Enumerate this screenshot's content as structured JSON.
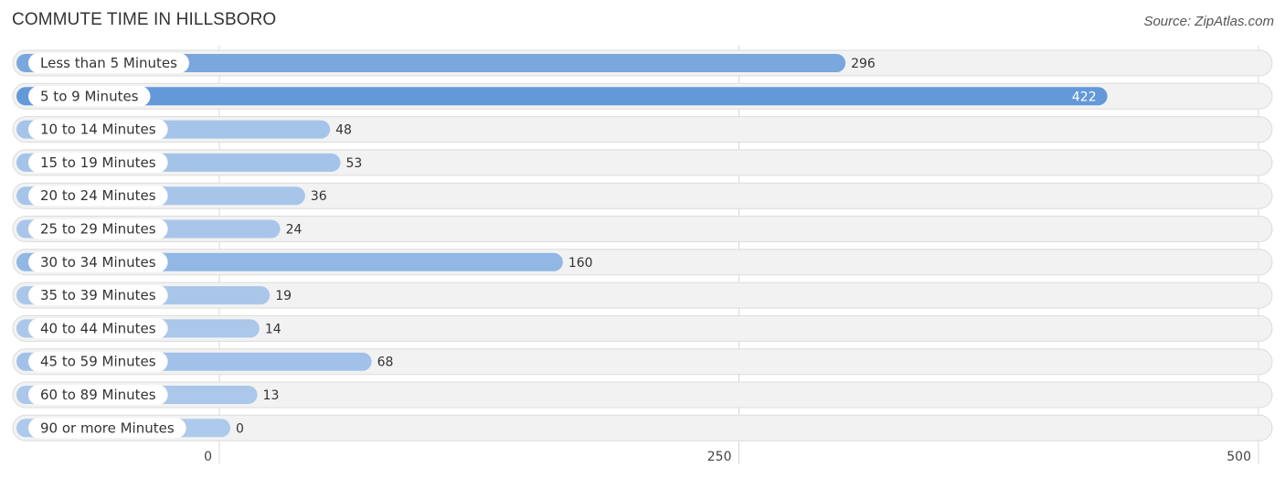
{
  "chart_data": {
    "type": "bar",
    "orientation": "horizontal",
    "title": "COMMUTE TIME IN HILLSBORO",
    "source": "Source: ZipAtlas.com",
    "categories": [
      "Less than 5 Minutes",
      "5 to 9 Minutes",
      "10 to 14 Minutes",
      "15 to 19 Minutes",
      "20 to 24 Minutes",
      "25 to 29 Minutes",
      "30 to 34 Minutes",
      "35 to 39 Minutes",
      "40 to 44 Minutes",
      "45 to 59 Minutes",
      "60 to 89 Minutes",
      "90 or more Minutes"
    ],
    "values": [
      296,
      422,
      48,
      53,
      36,
      24,
      160,
      19,
      14,
      68,
      13,
      0
    ],
    "value_labels": [
      "296",
      "422",
      "48",
      "53",
      "36",
      "24",
      "160",
      "19",
      "14",
      "68",
      "13",
      "0"
    ],
    "xlim": [
      0,
      500
    ],
    "x_ticks": [
      0,
      250,
      500
    ],
    "x_tick_labels": [
      "0",
      "250",
      "500"
    ],
    "grid": true,
    "xlabel": "",
    "ylabel": "",
    "colors": {
      "bar_max": "#6399d9",
      "bar_min": "#adc9eb",
      "track": "#f2f2f2",
      "text": "#333333"
    }
  }
}
